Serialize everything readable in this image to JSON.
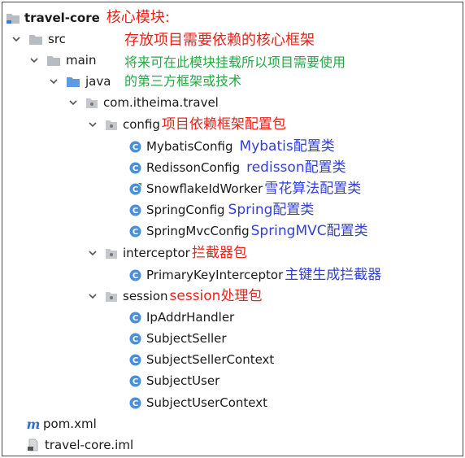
{
  "tree": {
    "root": {
      "label": "travel-core",
      "annotation": "核心模块:",
      "note": "存放项目需要依赖的核心框架"
    },
    "src": {
      "label": "src"
    },
    "main": {
      "label": "main",
      "note_line1": "将来可在此模块挂载所以项目需要使用",
      "note_line2": "的第三方框架或技术"
    },
    "java": {
      "label": "java"
    },
    "package": {
      "label": "com.itheima.travel"
    },
    "config": {
      "label": "config",
      "annotation": "项目依赖框架配置包",
      "items": [
        {
          "label": "MybatisConfig",
          "annotation": "Mybatis配置类"
        },
        {
          "label": "RedissonConfig",
          "annotation": "redisson配置类"
        },
        {
          "label": "SnowflakeIdWorker",
          "annotation": "雪花算法配置类"
        },
        {
          "label": "SpringConfig",
          "annotation": "Spring配置类"
        },
        {
          "label": "SpringMvcConfig",
          "annotation": "SpringMVC配置类"
        }
      ]
    },
    "interceptor": {
      "label": "interceptor",
      "annotation": "拦截器包",
      "items": [
        {
          "label": "PrimaryKeyInterceptor",
          "annotation": "主键生成拦截器"
        }
      ]
    },
    "session": {
      "label": "session",
      "annotation": "session处理包",
      "items": [
        {
          "label": "IpAddrHandler"
        },
        {
          "label": "SubjectSeller"
        },
        {
          "label": "SubjectSellerContext"
        },
        {
          "label": "SubjectUser"
        },
        {
          "label": "SubjectUserContext"
        }
      ]
    },
    "pom": {
      "label": "pom.xml",
      "icon_letter": "m"
    },
    "iml": {
      "label": "travel-core.iml"
    }
  },
  "colors": {
    "red": "#e8231b",
    "blue": "#3340d8",
    "green": "#25a845",
    "folder": "#b7bcc2",
    "class_icon": "#4a90d9"
  },
  "icons": {
    "chevron": "chevron-down-icon",
    "folder": "folder-icon",
    "package": "package-icon",
    "class": "java-class-icon",
    "maven": "maven-icon",
    "iml": "iml-file-icon"
  }
}
